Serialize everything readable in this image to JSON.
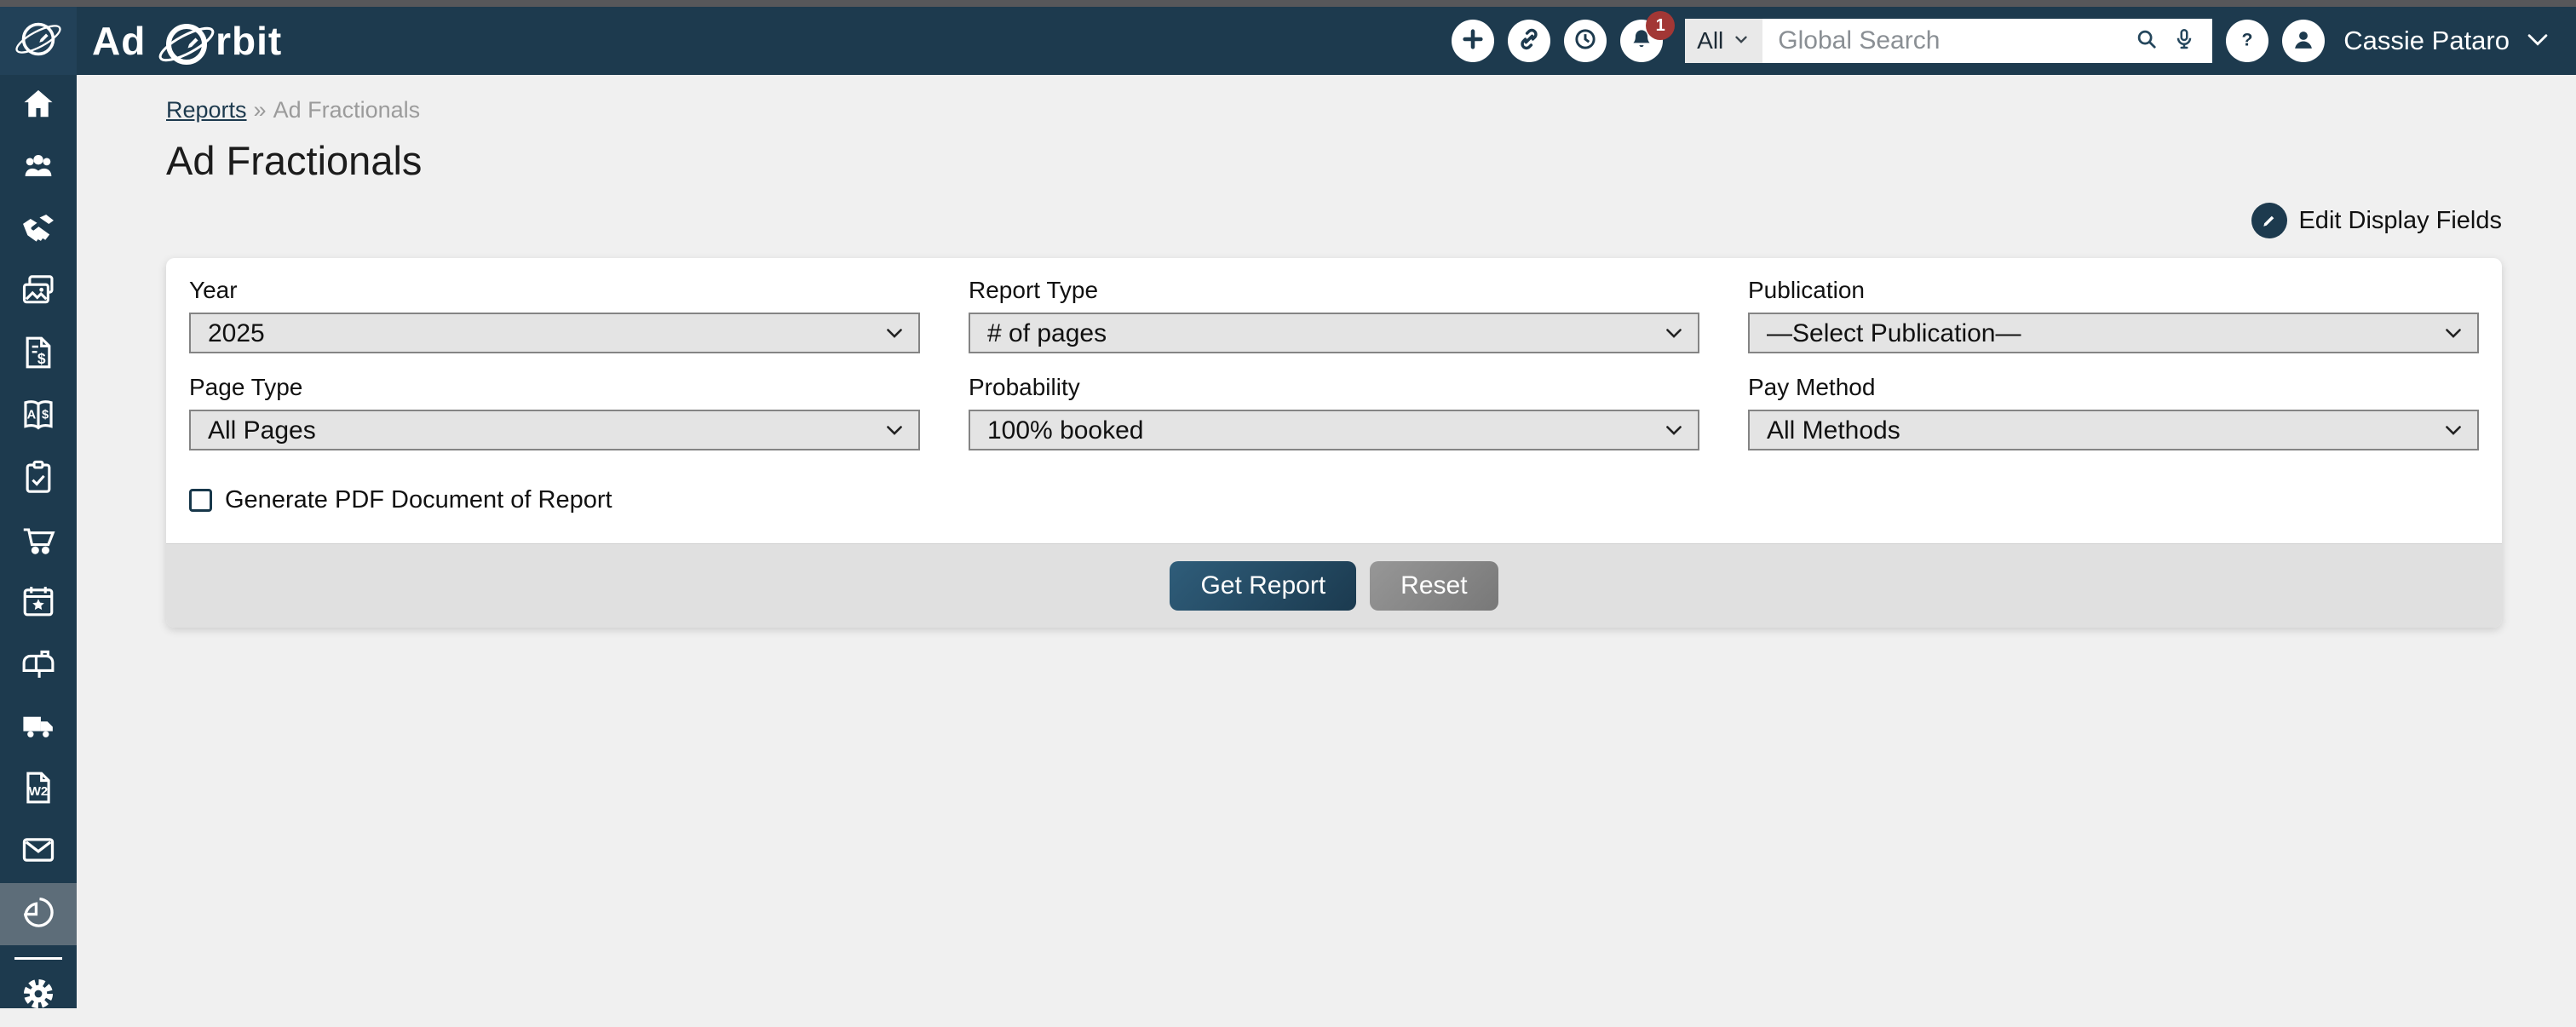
{
  "header": {
    "brand": "Ad Orbit",
    "notifications_badge": "1",
    "search": {
      "scope": "All",
      "placeholder": "Global Search"
    },
    "user": "Cassie Pataro",
    "icons": [
      "add-icon",
      "link-icon",
      "history-icon",
      "bell-icon",
      "search-icon",
      "microphone-icon",
      "help-icon",
      "avatar-icon",
      "chevron-down-icon"
    ]
  },
  "breadcrumb": {
    "parent": "Reports",
    "separator": "»",
    "current": "Ad Fractionals"
  },
  "page": {
    "title": "Ad Fractionals",
    "edit_display_fields": "Edit Display Fields"
  },
  "filters": {
    "year": {
      "label": "Year",
      "value": "2025"
    },
    "report_type": {
      "label": "Report Type",
      "value": "# of pages"
    },
    "publication": {
      "label": "Publication",
      "value": "—Select Publication—"
    },
    "page_type": {
      "label": "Page Type",
      "value": "All Pages"
    },
    "probability": {
      "label": "Probability",
      "value": "100% booked"
    },
    "pay_method": {
      "label": "Pay Method",
      "value": "All Methods"
    },
    "generate_pdf_label": "Generate PDF Document of Report",
    "generate_pdf_checked": false
  },
  "actions": {
    "get_report": "Get Report",
    "reset": "Reset"
  },
  "sidebar": {
    "items": [
      {
        "icon": "home-icon"
      },
      {
        "icon": "contacts-users-icon"
      },
      {
        "icon": "deals-handshake-icon"
      },
      {
        "icon": "creatives-images-icon"
      },
      {
        "icon": "invoice-dollar-icon"
      },
      {
        "icon": "rate-book-icon"
      },
      {
        "icon": "tasks-clipboard-check-icon"
      },
      {
        "icon": "orders-cart-icon"
      },
      {
        "icon": "events-calendar-star-icon"
      },
      {
        "icon": "mailbox-icon"
      },
      {
        "icon": "delivery-truck-icon"
      },
      {
        "icon": "w2-file-icon"
      },
      {
        "icon": "email-envelope-icon"
      },
      {
        "icon": "reports-pie-chart-icon",
        "active": true
      },
      {
        "icon": "settings-gear-icon"
      }
    ]
  },
  "colors": {
    "navy": "#1d3a4e",
    "top_strip": "#57575a",
    "sidebar_active": "#5d6d79",
    "badge_red": "#a23735",
    "select_bg": "#e4e4e4",
    "select_border": "#848484",
    "card_footer": "#e0e0e0",
    "page_bg": "#f0f0f0",
    "btn_primary_start": "#2f5d7a",
    "btn_primary_end": "#1b3a4f"
  }
}
